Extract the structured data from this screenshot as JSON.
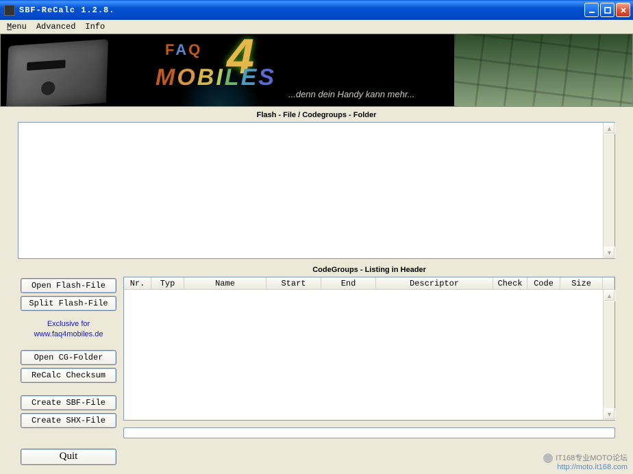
{
  "window": {
    "title": "SBF-ReCalc 1.2.8."
  },
  "menu": {
    "items": [
      "Menu",
      "Advanced",
      "Info"
    ]
  },
  "banner": {
    "brand_top": "FAQ",
    "brand_num": "4",
    "brand_bottom": "MOBILES",
    "tagline": "...denn dein Handy kann mehr..."
  },
  "sections": {
    "flash_label": "Flash - File / Codegroups - Folder",
    "codegroups_label": "CodeGroups - Listing in Header"
  },
  "sidebar": {
    "open_flash": "Open Flash-File",
    "split_flash": "Split Flash-File",
    "exclusive_line1": "Exclusive for",
    "exclusive_line2": "www.faq4mobiles.de",
    "open_cg": "Open CG-Folder",
    "recalc": "ReCalc Checksum",
    "create_sbf": "Create SBF-File",
    "create_shx": "Create SHX-File",
    "quit": "Quit"
  },
  "columns": {
    "nr": "Nr.",
    "typ": "Typ",
    "name": "Name",
    "start": "Start",
    "end": "End",
    "desc": "Descriptor",
    "check": "Check",
    "code": "Code",
    "size": "Size"
  },
  "rows": [],
  "watermark": {
    "line1": "IT168专业MOTO论坛",
    "line2": "http://moto.it168.com"
  }
}
